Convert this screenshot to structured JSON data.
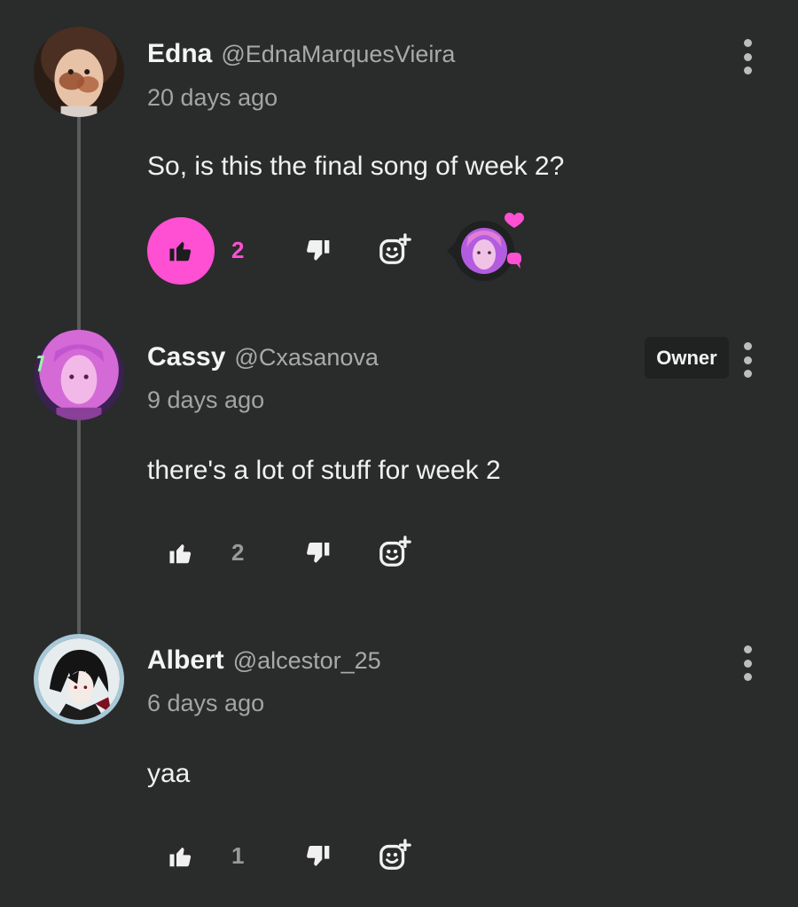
{
  "comments": [
    {
      "name": "Edna",
      "handle": "@EdnaMarquesVieira",
      "time": "20 days ago",
      "text": "So, is this the final song of week 2?",
      "likes": "2",
      "liked": true,
      "creator_heart": true
    },
    {
      "name": "Cassy",
      "handle": "@Cxasanova",
      "time": "9 days ago",
      "text": "there's a lot of stuff for week 2",
      "likes": "2",
      "liked": false,
      "badge": "Owner"
    },
    {
      "name": "Albert",
      "handle": "@alcestor_25",
      "time": "6 days ago",
      "text": "yaa",
      "likes": "1",
      "liked": false
    }
  ],
  "colors": {
    "background": "#2a2b2b",
    "accent": "#ff4fd3",
    "muted": "#a4a4a4",
    "thread_line": "#5a5b5b"
  }
}
